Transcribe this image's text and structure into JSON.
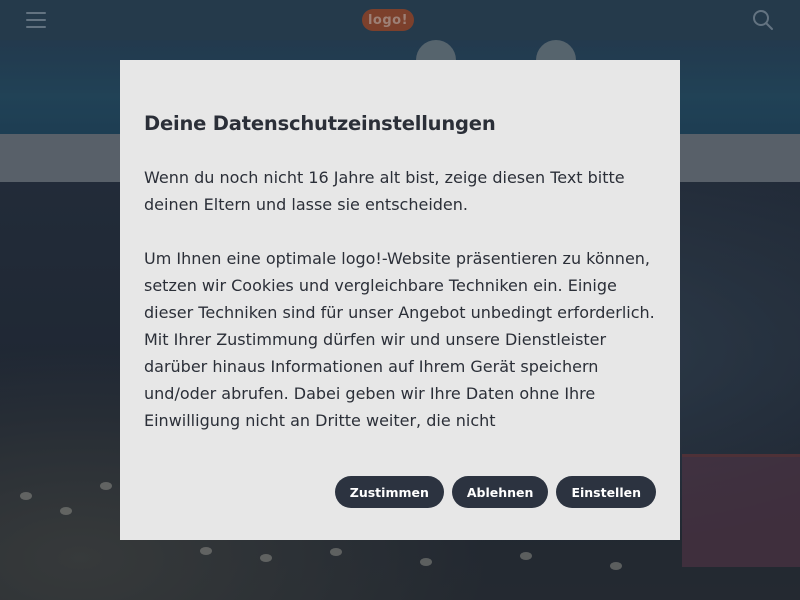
{
  "header": {
    "menu_icon": "hamburger-menu-icon",
    "logo_text": "logo!",
    "search_icon": "search-icon",
    "bar_color": "#2f4a5e",
    "logo_color": "#b4542f"
  },
  "consent_dialog": {
    "title": "Deine Datenschutzeinstellungen",
    "paragraphs": [
      "Wenn du noch nicht 16 Jahre alt bist, zeige diesen Text bitte deinen Eltern und lasse sie entscheiden.",
      "Um Ihnen eine optimale logo!-Website präsentieren zu können, setzen wir Cookies und vergleichbare Techniken ein. Einige dieser Techniken sind für unser Angebot unbedingt erforderlich. Mit Ihrer Zustimmung dürfen wir und unsere Dienstleister darüber hinaus Informationen auf Ihrem Gerät speichern und/oder abrufen. Dabei geben wir Ihre Daten ohne Ihre Einwilligung nicht an Dritte weiter, die nicht"
    ],
    "buttons": {
      "accept": "Zustimmen",
      "reject": "Ablehnen",
      "settings": "Einstellen"
    },
    "background_color": "#e7e7e7",
    "button_color": "#2c3340"
  }
}
